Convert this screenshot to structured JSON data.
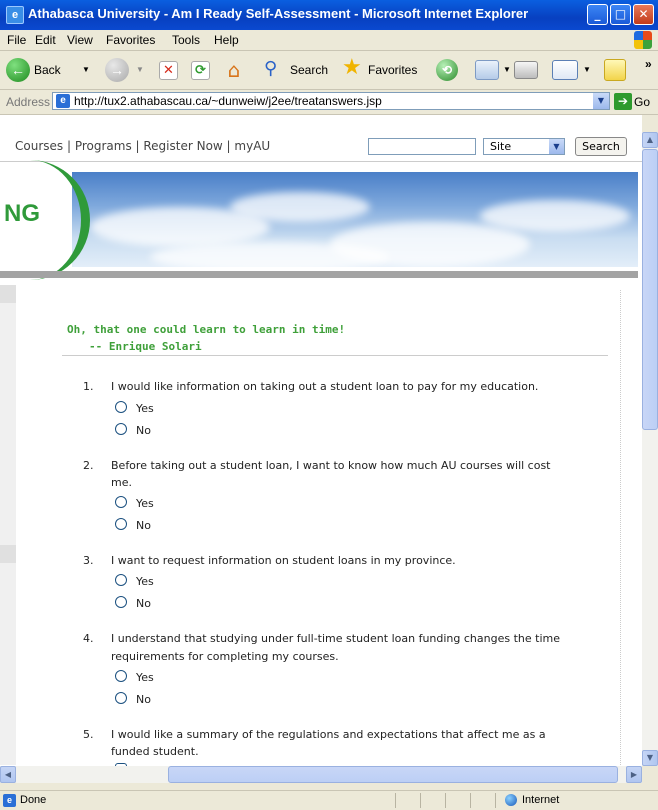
{
  "window": {
    "title": "Athabasca University - Am I Ready Self-Assessment - Microsoft Internet Explorer",
    "icon": "ie-page-icon",
    "controls": [
      "minimize",
      "maximize",
      "close"
    ]
  },
  "menu": {
    "items": [
      {
        "label": "File",
        "accel": "F"
      },
      {
        "label": "Edit",
        "accel": "E"
      },
      {
        "label": "View",
        "accel": "V"
      },
      {
        "label": "Favorites",
        "accel": "a"
      },
      {
        "label": "Tools",
        "accel": "T"
      },
      {
        "label": "Help",
        "accel": "H"
      }
    ]
  },
  "toolbar": {
    "back_label": "Back",
    "search_label": "Search",
    "favorites_label": "Favorites",
    "overflow": "»"
  },
  "address": {
    "label": "Address",
    "url": "http://tux2.athabascau.ca/~dunweiw/j2ee/treatanswers.jsp",
    "go_label": "Go"
  },
  "site_nav": {
    "links_text": "Courses | Programs | Register Now | myAU",
    "search_value": "",
    "scope_selected": "Site",
    "search_button": "Search"
  },
  "banner": {
    "logo_fragment": "NG"
  },
  "quote": {
    "line1": "Oh, that one could learn to learn in time!",
    "line2": "-- Enrique Solari"
  },
  "questions": [
    {
      "num": "1.",
      "lines": [
        "I would like information on taking out a student loan to pay for my education."
      ],
      "options": [
        "Yes",
        "No"
      ]
    },
    {
      "num": "2.",
      "lines": [
        "Before taking out a student loan, I want to know how much AU courses will cost",
        "me."
      ],
      "options": [
        "Yes",
        "No"
      ]
    },
    {
      "num": "3.",
      "lines": [
        "I want to request information on student loans in my province."
      ],
      "options": [
        "Yes",
        "No"
      ]
    },
    {
      "num": "4.",
      "lines": [
        "I understand that studying under full-time student loan funding changes the time",
        "requirements for completing my courses."
      ],
      "options": [
        "Yes",
        "No"
      ]
    },
    {
      "num": "5.",
      "lines": [
        "I would like a summary of the regulations and expectations that affect me as a",
        "funded student."
      ],
      "options": []
    }
  ],
  "status": {
    "text": "Done",
    "zone": "Internet"
  }
}
